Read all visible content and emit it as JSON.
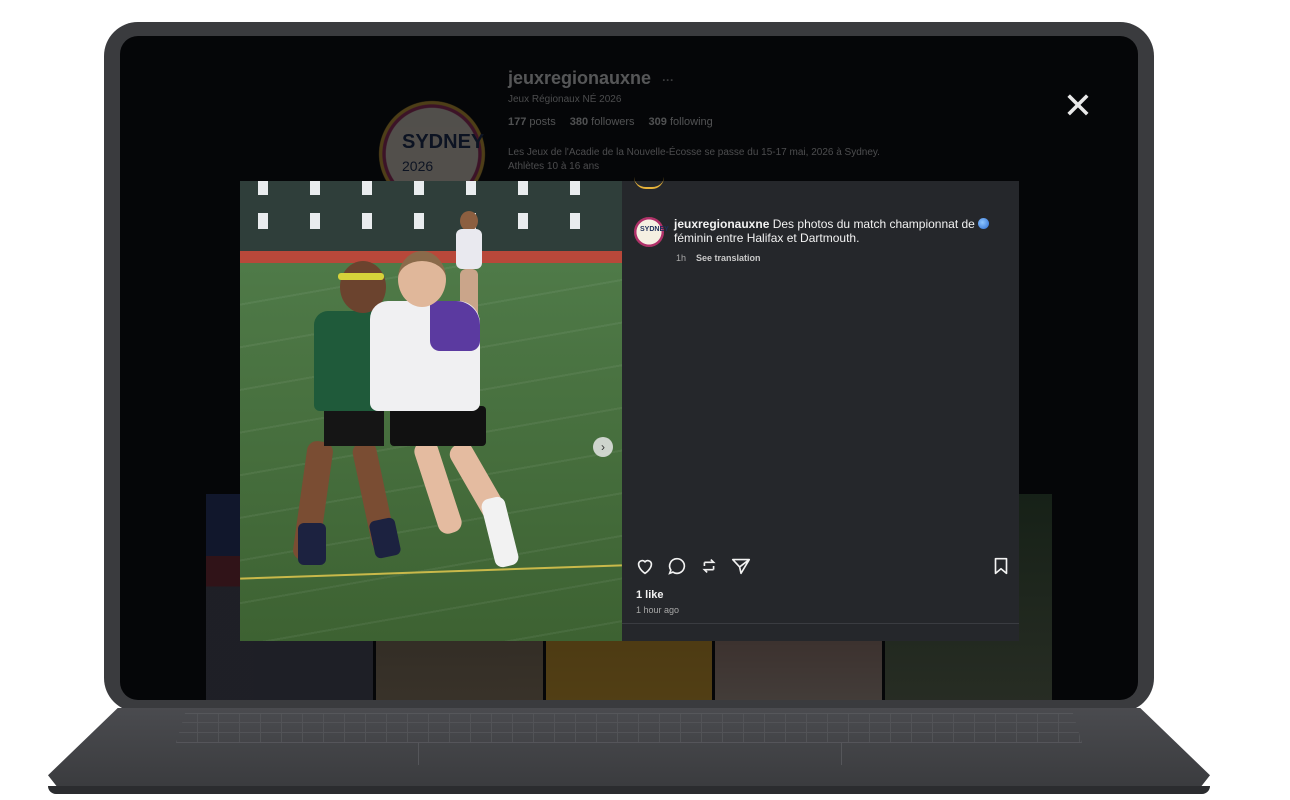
{
  "profile": {
    "username": "jeuxregionauxne",
    "more": "···",
    "subtitle": "Jeux Régionaux NÉ 2026",
    "posts_count": "177",
    "posts_label": "posts",
    "followers_count": "380",
    "followers_label": "followers",
    "following_count": "309",
    "following_label": "following",
    "bio_line1": "Les Jeux de l'Acadie de la Nouvelle-Écosse se passe du 15-17 mai, 2026 à Sydney.",
    "bio_line2": "Athlètes 10 à 16 ans",
    "avatar_text": "SYDNEY",
    "avatar_year": "2026"
  },
  "close": {
    "glyph": "✕",
    "icon": "close-icon"
  },
  "post": {
    "next_glyph": "›",
    "author": "jeuxregionauxne",
    "caption_part1": "Des photos du match championnat de",
    "caption_part2": "féminin entre Halifax et Dartmouth.",
    "avatar_text": "SYDNEY",
    "age": "1h",
    "see_translation": "See translation",
    "likes": "1 like",
    "time_ago": "1 hour ago"
  },
  "icons": {
    "like": "heart-icon",
    "comment": "comment-icon",
    "share": "repost-icon",
    "send": "send-icon",
    "save": "bookmark-icon"
  },
  "colors": {
    "panel_bg": "#25272b",
    "accent_ring": "#e6b23a"
  }
}
